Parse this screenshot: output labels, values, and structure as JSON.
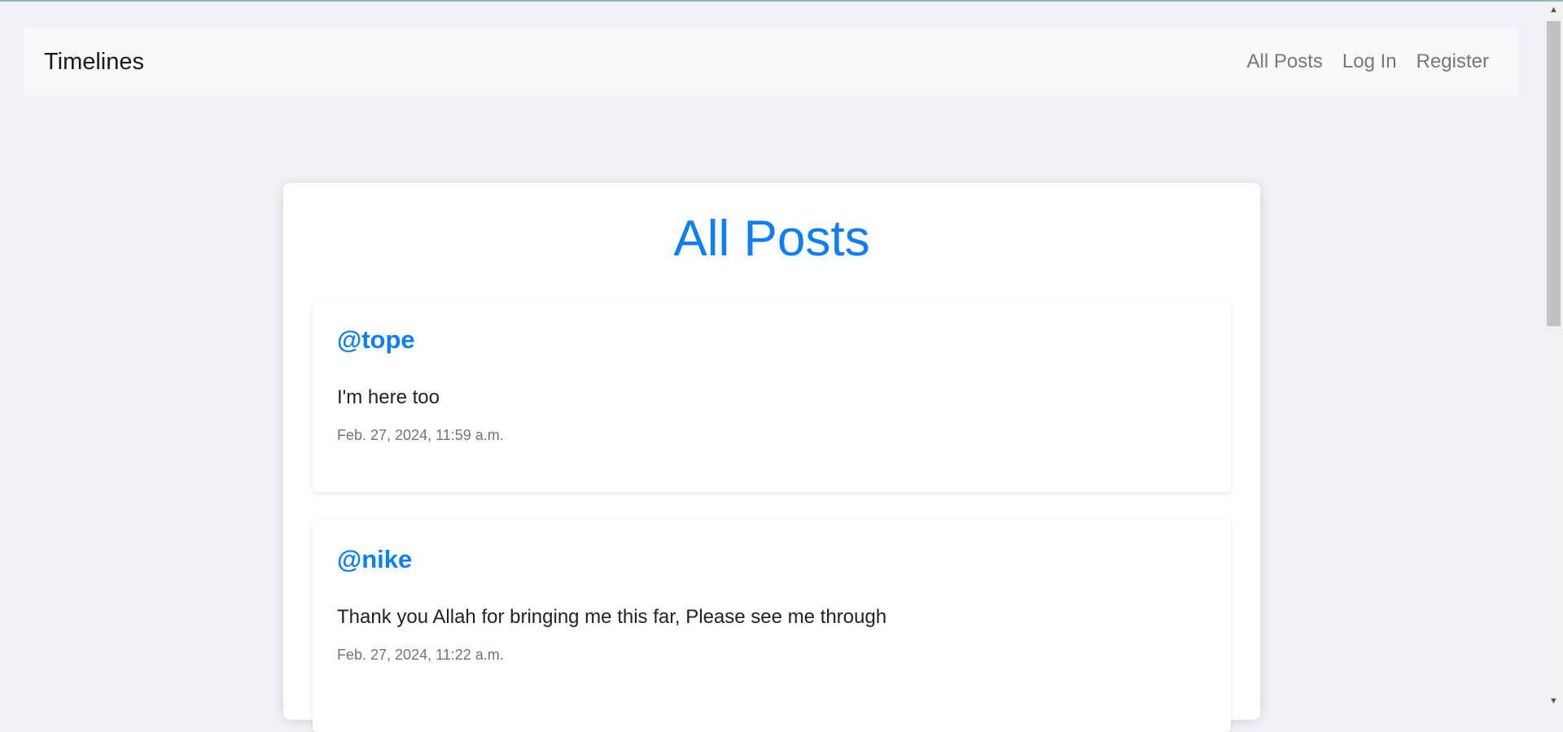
{
  "navbar": {
    "brand": "Timelines",
    "links": [
      {
        "label": "All Posts"
      },
      {
        "label": "Log In"
      },
      {
        "label": "Register"
      }
    ]
  },
  "main": {
    "title": "All Posts",
    "posts": [
      {
        "username": "@tope",
        "body": "I'm here too",
        "timestamp": "Feb. 27, 2024, 11:59 a.m."
      },
      {
        "username": "@nike",
        "body": "Thank you Allah for bringing me this far, Please see me through",
        "timestamp": "Feb. 27, 2024, 11:22 a.m."
      }
    ]
  },
  "scrollbar": {
    "up_icon": "▲",
    "down_icon": "▼"
  },
  "colors": {
    "accent": "#0d7ff2",
    "background": "#f0f2f5",
    "navbar": "#f8f9fa"
  }
}
